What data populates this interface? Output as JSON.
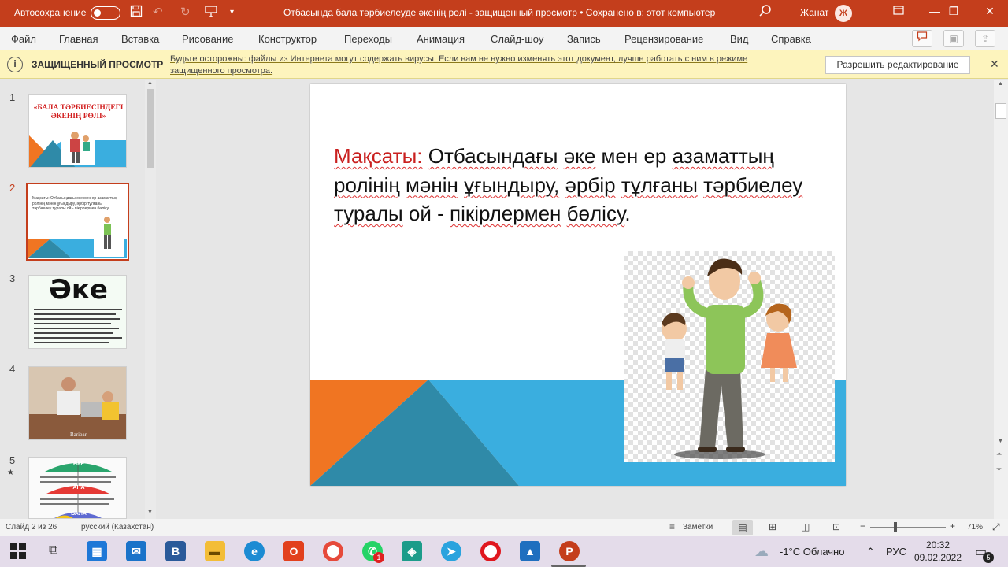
{
  "titlebar": {
    "autosave_label": "Автосохранение",
    "autosave_state": "off",
    "doc_title": "Отбасында бала тәрбиелеуде әкенің рөлі  -  защищенный просмотр • Сохранено в: этот компьютер",
    "user_name": "Жанат",
    "user_initial": "Ж"
  },
  "menu": [
    "Файл",
    "Главная",
    "Вставка",
    "Рисование",
    "Конструктор",
    "Переходы",
    "Анимация",
    "Слайд-шоу",
    "Запись",
    "Рецензирование",
    "Вид",
    "Справка"
  ],
  "protected": {
    "label": "ЗАЩИЩЕННЫЙ ПРОСМОТР",
    "message": "Будьте осторожны: файлы из Интернета могут содержать вирусы. Если вам не нужно изменять этот документ, лучше работать с ним в режиме защищенного просмотра.",
    "button": "Разрешить редактирование"
  },
  "thumbnails": {
    "numbers": [
      "1",
      "2",
      "3",
      "4",
      "5"
    ],
    "slide1_title": "«БАЛА ТӘРБИЕСІНДЕГІ ӘКЕНІҢ РӨЛІ»",
    "slide2_text": "Мақсаты: Отбасындағы әке мен ер азаматтың ролінің мәнін ұғындыру, әрбір тұлғаны тәрбиелеу туралы ой - пікірлермен бөлісу",
    "slide3_title": "Әке",
    "slide4_caption": "Baribar",
    "slide5_labels": [
      "ӘКЕ",
      "АНА",
      "БАЛА"
    ],
    "star": "★"
  },
  "slide": {
    "keyword": "Мақсаты:",
    "w1": "Отбасындағы",
    "w2": "әке",
    "w3": "мен ер",
    "w4": "азаматтың ролінің",
    "w5": "мәнін",
    "w6": "ұғындыру,",
    "w7": "әрбір",
    "w8": "тұлғаны",
    "w9": "тәрбиелеу",
    "w10": "туралы",
    "w11": "ой -",
    "w12": "пікірлермен",
    "w13": "бөлісу",
    "w14": ".",
    "colors": {
      "orange": "#f07522",
      "blue": "#3aaedf",
      "teal": "#2f8aa8",
      "keyword": "#c9201f"
    }
  },
  "status": {
    "slide_counter": "Слайд 2 из 26",
    "language": "русский (Казахстан)",
    "notes": "Заметки",
    "zoom": "71%"
  },
  "taskbar": {
    "weather": "-1°C  Облачно",
    "lang": "РУС",
    "time": "20:32",
    "date": "09.02.2022",
    "whatsapp_badge": "1",
    "notif_count": "5"
  }
}
